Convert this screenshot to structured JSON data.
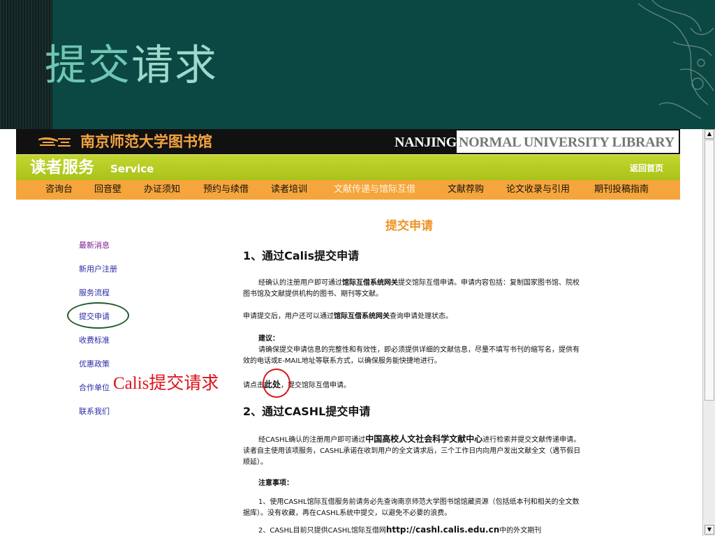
{
  "slide": {
    "title_part1": "提交",
    "title_part2": "请求",
    "colors": {
      "bg": "#0b4843",
      "title": "#6fc6b3"
    }
  },
  "banner": {
    "name_cn": "南京师范大学图书馆",
    "name_en_1": "NANJING",
    "name_en_2": "NORMAL UNIVERSITY LIBRARY"
  },
  "service_bar": {
    "title": "读者服务",
    "subtitle": "Service",
    "home_link": "返回首页"
  },
  "nav": [
    "咨询台",
    "回音壁",
    "办证须知",
    "预约与续借",
    "读者培训",
    "文献传递与馆际互借",
    "文献荐购",
    "论文收录与引用",
    "期刊投稿指南"
  ],
  "sidebar": [
    "最新消息",
    "新用户注册",
    "服务流程",
    "提交申请",
    "收费标准",
    "优惠政策",
    "合作单位",
    "联系我们"
  ],
  "annotation": "Calis提交请求",
  "content": {
    "page_title": "提交申请",
    "sec1_title": "1、通过Calis提交申请",
    "sec1_p1_a": "经确认的注册用户即可通过",
    "sec1_p1_b": "馆际互借系统网关",
    "sec1_p1_c": "提交馆际互借申请。申请内容包括：复制国家图书馆、院校图书馆及文献提供机构的图书、期刊等文献。",
    "sec1_p2_a": "申请提交后，用户还可以通过",
    "sec1_p2_b": "馆际互借系统网关",
    "sec1_p2_c": "查询申请处理状态。",
    "sec1_advice_label": "建议：",
    "sec1_advice_text": "请确保提交申请信息的完整性和有效性，即必须提供详细的文献信息，尽量不填写书刊的缩写名，提供有效的电话或E-MAIL地址等联系方式，以确保服务能快捷地进行。",
    "sec1_click_a": "请点击",
    "sec1_click_b": "此处",
    "sec1_click_c": "，提交馆际互借申请。",
    "sec2_title": "2、通过CASHL提交申请",
    "sec2_p1_a": "经CASHL确认的注册用户即可通过",
    "sec2_p1_b": "中国高校人文社会科学文献中心",
    "sec2_p1_c": "进行检索并提交文献传递申请。读者自主使用该项服务，CASHL承诺在收到用户的全文请求后，三个工作日内向用户发出文献全文（遇节假日顺延）。",
    "sec2_notes_label": "注意事项：",
    "sec2_note1": "1、使用CASHL馆际互借服务前请务必先查询南京师范大学图书馆馆藏资源（包括纸本刊和相关的全文数据库）。没有收藏，再在CASHL系统中提交，以避免不必要的浪费。",
    "sec2_note2_a": "2、CASHL目前只提供CASHL馆际互借网",
    "sec2_note2_b": "http://cashl.calis.edu.cn",
    "sec2_note2_c": "中的外文期刊"
  },
  "scrollbar": {
    "up_icon": "▲",
    "down_icon": "▼"
  }
}
